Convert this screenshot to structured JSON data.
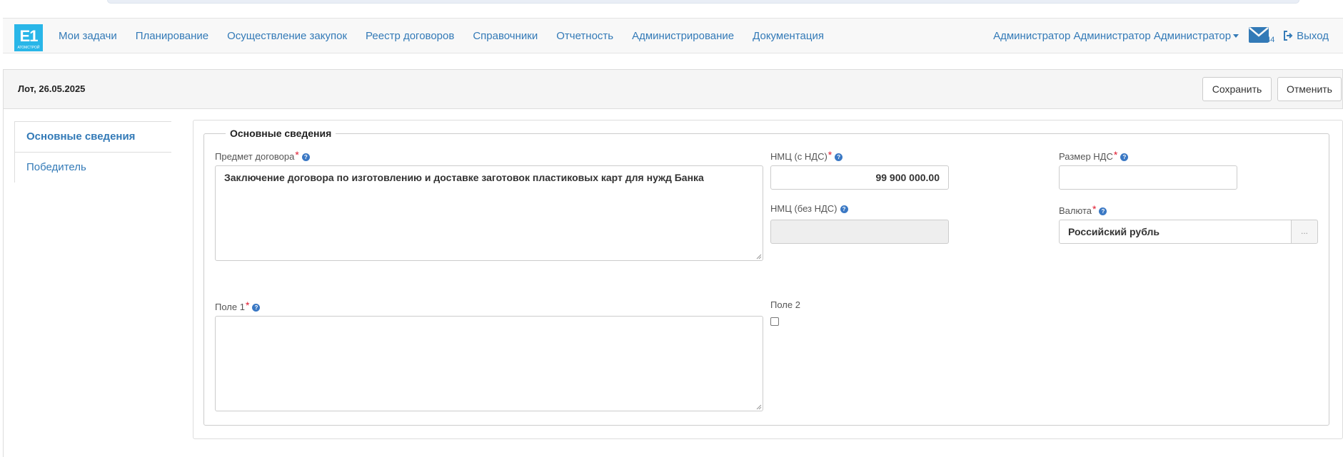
{
  "navbar": {
    "logo_text": "E1",
    "logo_sub": "АТОМСТРОЙ",
    "items": [
      {
        "label": "Мои задачи"
      },
      {
        "label": "Планирование"
      },
      {
        "label": "Осуществление закупок"
      },
      {
        "label": "Реестр договоров"
      },
      {
        "label": "Справочники"
      },
      {
        "label": "Отчетность"
      },
      {
        "label": "Администрирование"
      },
      {
        "label": "Документация"
      }
    ],
    "user": "Администратор Администратор Администратор",
    "mail_count": "44",
    "logout": "Выход"
  },
  "header": {
    "title": "Лот, 26.05.2025",
    "save_label": "Сохранить",
    "cancel_label": "Отменить"
  },
  "tabs": [
    {
      "label": "Основные сведения",
      "active": true
    },
    {
      "label": "Победитель",
      "active": false
    }
  ],
  "form": {
    "legend": "Основные сведения",
    "subject_label": "Предмет договора",
    "subject_value": "Заключение договора по изготовлению и доставке заготовок пластиковых карт для нужд Банка",
    "nmc_vat_label": "НМЦ (с НДС)",
    "nmc_vat_value": "99 900 000.00",
    "vat_size_label": "Размер НДС",
    "vat_size_value": "",
    "nmc_novat_label": "НМЦ (без НДС)",
    "nmc_novat_value": "",
    "currency_label": "Валюта",
    "currency_value": "Российский рубль",
    "currency_button": "...",
    "field1_label": "Поле 1",
    "field1_value": "",
    "field2_label": "Поле 2",
    "field2_checked": false
  },
  "colors": {
    "link": "#337ab7",
    "logo": "#29b6e8",
    "required": "#e0182d",
    "help": "#3a78c4"
  }
}
